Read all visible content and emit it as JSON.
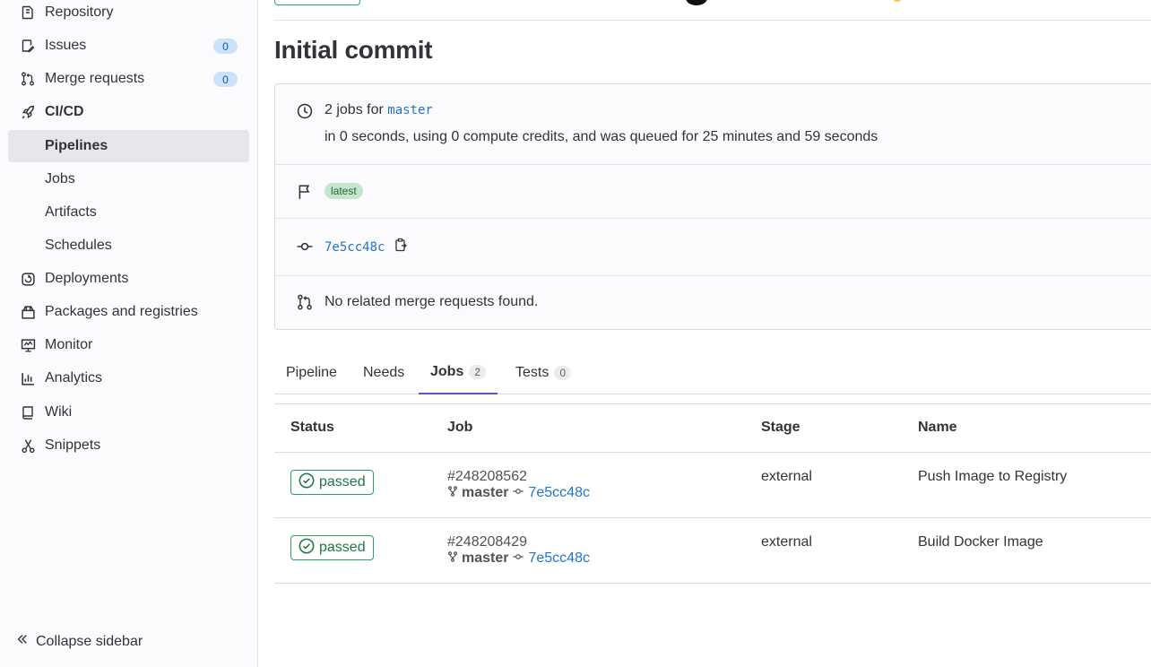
{
  "sidebar": {
    "items": [
      {
        "label": "Repository",
        "icon": "repository-icon"
      },
      {
        "label": "Issues",
        "icon": "issues-icon",
        "count": "0"
      },
      {
        "label": "Merge requests",
        "icon": "merge-request-icon",
        "count": "0"
      },
      {
        "label": "CI/CD",
        "icon": "rocket-icon"
      },
      {
        "label": "Pipelines",
        "active": true
      },
      {
        "label": "Jobs"
      },
      {
        "label": "Artifacts"
      },
      {
        "label": "Schedules"
      },
      {
        "label": "Deployments",
        "icon": "deployments-icon"
      },
      {
        "label": "Packages and registries",
        "icon": "package-icon"
      },
      {
        "label": "Monitor",
        "icon": "monitor-icon"
      },
      {
        "label": "Analytics",
        "icon": "chart-icon"
      },
      {
        "label": "Wiki",
        "icon": "book-icon"
      },
      {
        "label": "Snippets",
        "icon": "scissors-icon"
      }
    ],
    "collapse_label": "Collapse sidebar"
  },
  "pipeline": {
    "title": "Initial commit",
    "jobs_prefix": "2 jobs for",
    "branch": "master",
    "duration_text": "in 0 seconds, using 0 compute credits, and was queued for 25 minutes and 59 seconds",
    "badge": "latest",
    "commit_sha": "7e5cc48c",
    "merge_requests_text": "No related merge requests found."
  },
  "tabs": [
    {
      "label": "Pipeline"
    },
    {
      "label": "Needs"
    },
    {
      "label": "Jobs",
      "count": "2",
      "active": true
    },
    {
      "label": "Tests",
      "count": "0"
    }
  ],
  "jobs_table": {
    "headers": [
      "Status",
      "Job",
      "Stage",
      "Name"
    ],
    "rows": [
      {
        "status": "passed",
        "id": "#248208562",
        "branch": "master",
        "sha": "7e5cc48c",
        "stage": "external",
        "name": "Push Image to Registry"
      },
      {
        "status": "passed",
        "id": "#248208429",
        "branch": "master",
        "sha": "7e5cc48c",
        "stage": "external",
        "name": "Build Docker Image"
      }
    ]
  },
  "colors": {
    "success": "#2da160",
    "link": "#1f75cb",
    "active_tab": "#6e49cb",
    "count_badge": "#cbe2f9"
  }
}
